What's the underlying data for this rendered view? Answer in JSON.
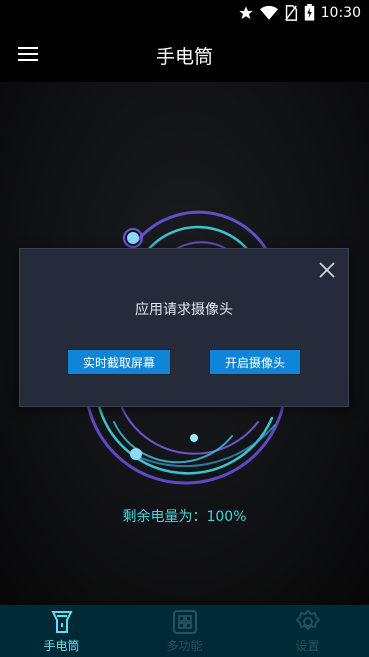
{
  "status_bar": {
    "time": "10:30"
  },
  "app_bar": {
    "title": "手电筒"
  },
  "main": {
    "battery_text": "剩余电量为：100%"
  },
  "dialog": {
    "message": "应用请求摄像头",
    "left_button": "实时截取屏幕",
    "right_button": "开启摄像头"
  },
  "bottom_nav": {
    "items": [
      {
        "label": "手电筒",
        "icon": "flashlight-icon",
        "active": true
      },
      {
        "label": "多功能",
        "icon": "grid-icon",
        "active": false
      },
      {
        "label": "设置",
        "icon": "gear-icon",
        "active": false
      }
    ]
  },
  "colors": {
    "accent": "#45d5d8",
    "dialog_bg": "#262b3b",
    "button_blue": "#0e85d6",
    "nav_bg": "#002a35"
  }
}
